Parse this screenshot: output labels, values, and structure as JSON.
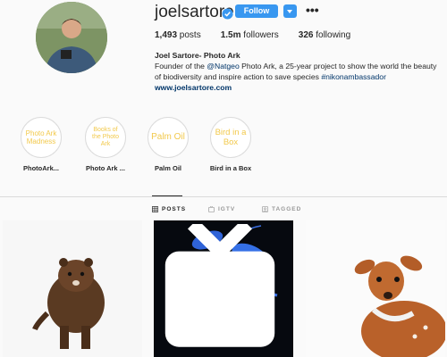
{
  "profile": {
    "username": "joelsartore",
    "follow_label": "Follow",
    "stats": [
      {
        "count": "1,493",
        "label": " posts"
      },
      {
        "count": "1.5m",
        "label": " followers"
      },
      {
        "count": "326",
        "label": " following"
      }
    ],
    "bio": {
      "name": "Joel Sartore- Photo Ark",
      "line1_prefix": "Founder of the ",
      "mention": "@Natgeo",
      "line1_suffix": " Photo Ark, a 25-year project to show the world the beauty",
      "line2_prefix": "of biodiversity and inspire action to save species ",
      "hashtag": "#nikonambassador",
      "website": "www.joelsartore.com"
    }
  },
  "highlights": [
    {
      "circle_text": "Photo Ark Madness",
      "label": "PhotoArk..."
    },
    {
      "circle_text": "Books of the Photo Ark",
      "label": "Photo Ark ..."
    },
    {
      "circle_text": "Palm Oil",
      "label": "Palm Oil"
    },
    {
      "circle_text": "Bird in a Box",
      "label": "Bird in a Box"
    }
  ],
  "tabs": [
    {
      "label": "POSTS",
      "icon": "grid-icon"
    },
    {
      "label": "IGTV",
      "icon": "igtv-icon"
    },
    {
      "label": "TAGGED",
      "icon": "tagged-icon"
    }
  ],
  "colors": {
    "accent": "#3897f0",
    "highlight_text": "#f2c94c",
    "link": "#003569"
  },
  "posts": [
    {
      "subject": "mink"
    },
    {
      "subject": "blue crayfish",
      "badge": "igtv-icon"
    },
    {
      "subject": "deer fawn"
    }
  ]
}
